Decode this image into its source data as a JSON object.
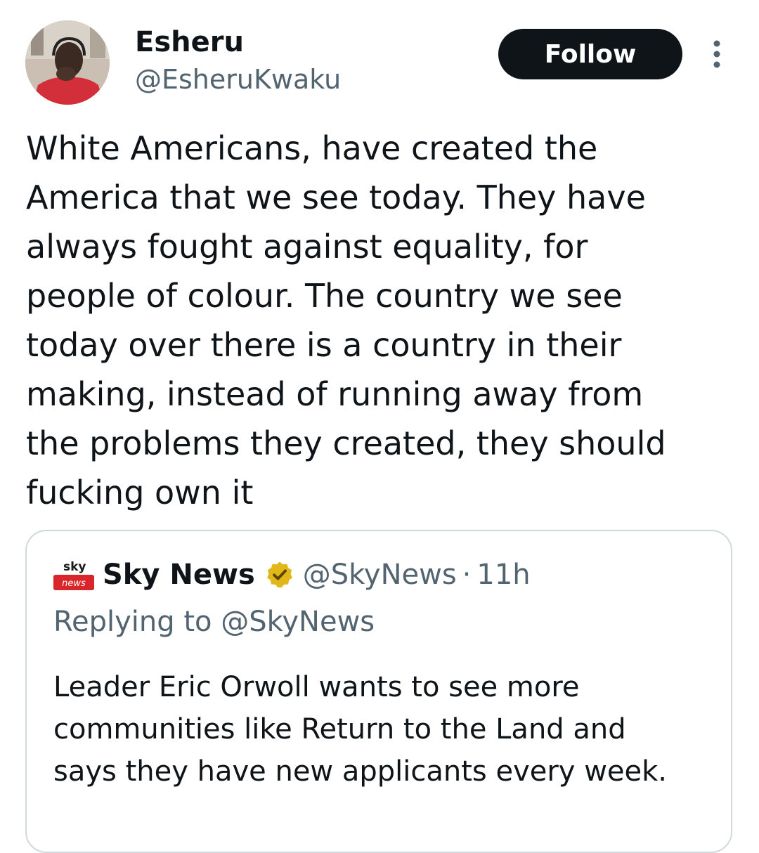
{
  "author": {
    "display_name": "Esheru",
    "handle": "@EsheruKwaku",
    "avatar_icon": "profile-photo"
  },
  "actions": {
    "follow_label": "Follow",
    "more_icon": "vertical-ellipsis-icon"
  },
  "tweet": {
    "text": "White Americans, have created the\nAmerica that we see today. They have\nalways fought against equality, for\npeople of colour. The country we see\ntoday over there is a country in their\nmaking, instead of running away from\nthe problems they created, they should\nfucking own it"
  },
  "quoted_tweet": {
    "avatar_icon": "sky-news-logo",
    "logo_text_top": "sky",
    "logo_text_bottom": "news",
    "display_name": "Sky News",
    "verified_icon": "gold-verified-badge-icon",
    "handle": "@SkyNews",
    "separator": "·",
    "time": "11h",
    "replying_prefix": "Replying to ",
    "replying_to": "@SkyNews",
    "text": "Leader Eric Orwoll wants to see more\ncommunities like Return to the Land and\nsays they have new applicants every week."
  },
  "colors": {
    "text_primary": "#0f1419",
    "text_secondary": "#536471",
    "follow_bg": "#0f1419",
    "follow_text": "#ffffff",
    "border": "#cfd9de",
    "verified_gold": "#e2b719",
    "sky_red": "#d8262b"
  }
}
